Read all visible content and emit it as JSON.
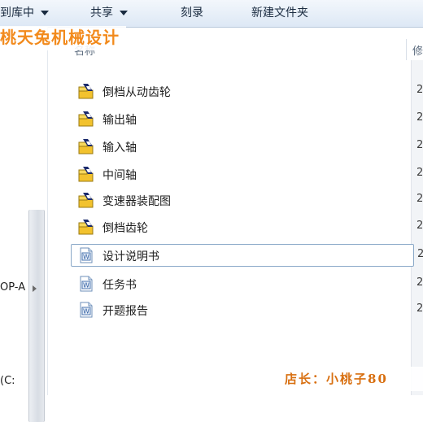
{
  "toolbar": {
    "library_label": "到库中",
    "share_label": "共享",
    "burn_label": "刻录",
    "new_folder_label": "新建文件夹"
  },
  "watermark": {
    "top_text": "桃天兔机械设计",
    "bottom_text": "店长：小桃子80"
  },
  "nav": {
    "items": [
      {
        "label": "OP-A"
      },
      {
        "label": "(C:"
      }
    ]
  },
  "columns": {
    "name": "名称",
    "date": "修"
  },
  "files": [
    {
      "name": "倒档从动齿轮",
      "type": "cad",
      "date": "2"
    },
    {
      "name": "输出轴",
      "type": "cad",
      "date": "2"
    },
    {
      "name": "输入轴",
      "type": "cad",
      "date": "2"
    },
    {
      "name": "中间轴",
      "type": "cad",
      "date": "2"
    },
    {
      "name": "变速器装配图",
      "type": "cad",
      "date": "2"
    },
    {
      "name": "倒档齿轮",
      "type": "cad",
      "date": "2"
    },
    {
      "name": "设计说明书",
      "type": "word",
      "date": "2"
    },
    {
      "name": "任务书",
      "type": "word",
      "date": "2"
    },
    {
      "name": "开题报告",
      "type": "word",
      "date": "2"
    }
  ]
}
